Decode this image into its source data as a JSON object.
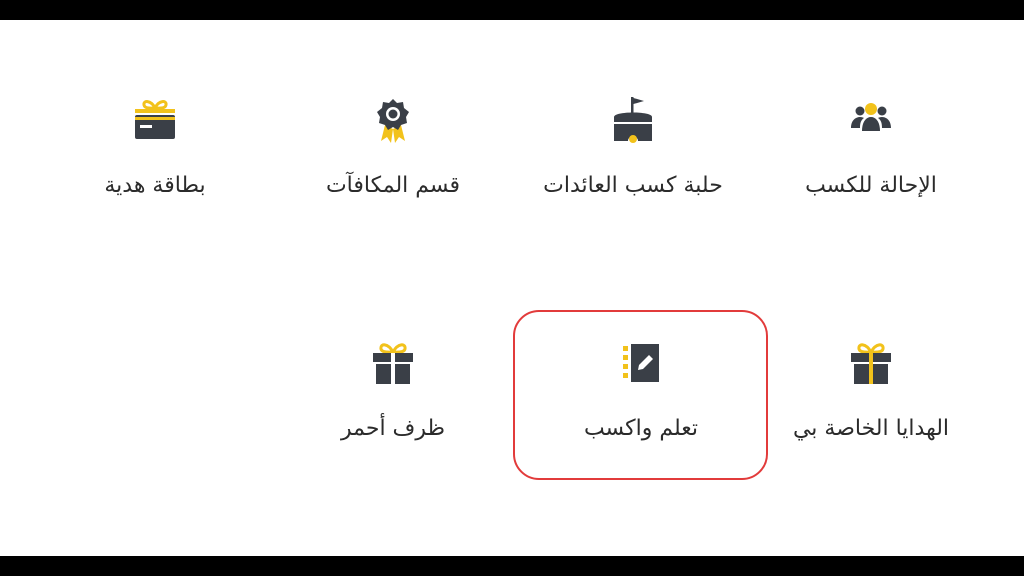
{
  "colors": {
    "accent": "#f2c21b",
    "icon_dark": "#3a3f47",
    "text": "#2b2b2b",
    "highlight": "#e23b3b"
  },
  "grid": {
    "row1": [
      {
        "label": "الإحالة للكسب",
        "icon": "referral-users-icon"
      },
      {
        "label": "حلبة كسب العائدات",
        "icon": "arena-flag-icon"
      },
      {
        "label": "قسم المكافآت",
        "icon": "reward-medal-icon"
      },
      {
        "label": "بطاقة هدية",
        "icon": "gift-card-icon"
      }
    ],
    "row2": [
      {
        "label": "الهدايا الخاصة بي",
        "icon": "gift-box-icon"
      },
      {
        "label": "تعلم واكسب",
        "icon": "notebook-pencil-icon"
      },
      {
        "label": "ظرف أحمر",
        "icon": "red-envelope-gift-icon"
      }
    ]
  }
}
